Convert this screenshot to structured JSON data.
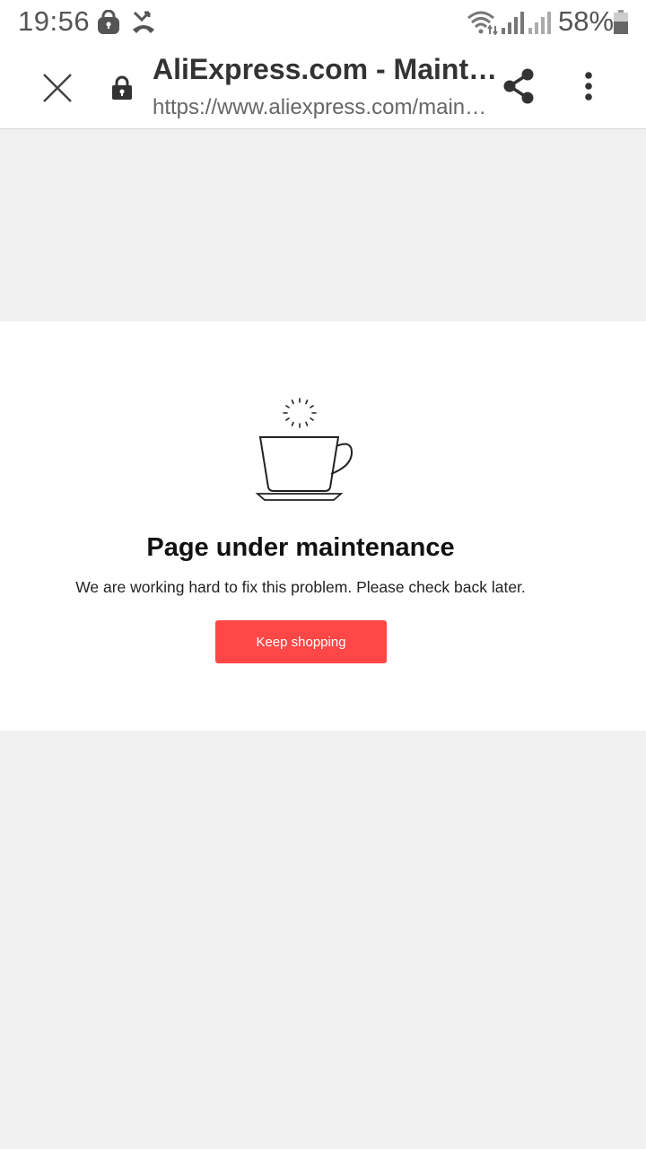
{
  "status_bar": {
    "time": "19:56",
    "battery": "58%",
    "icons": [
      "lock-icon",
      "missed-call-icon",
      "wifi-icon",
      "signal-icon",
      "signal-icon",
      "battery-icon"
    ]
  },
  "toolbar": {
    "title": "AliExpress.com - Maintenance",
    "url": "https://www.aliexpress.com/maintenance",
    "icons": [
      "close-icon",
      "lock-icon",
      "share-icon",
      "more-vert-icon"
    ]
  },
  "maintenance": {
    "heading": "Page under maintenance",
    "message": "We are working hard to fix this problem. Please check back later.",
    "button_label": "Keep shopping",
    "illustration": "coffee-cup-icon"
  },
  "colors": {
    "accent": "#ff4747",
    "page_background": "#f0f0f0",
    "panel_background": "#ffffff"
  }
}
